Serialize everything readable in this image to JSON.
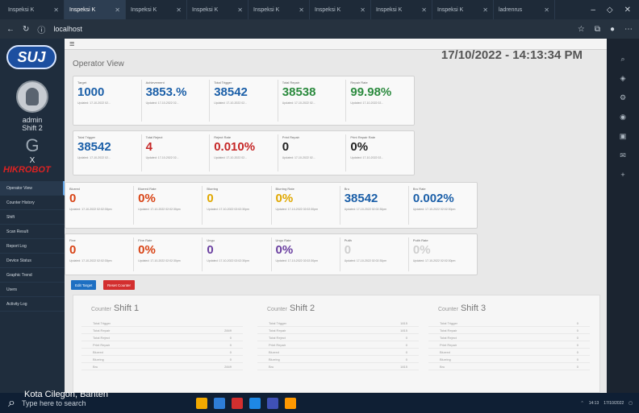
{
  "browser": {
    "tabs": [
      "Inspeksi K",
      "Inspeksi K",
      "Inspeksi K",
      "Inspeksi K",
      "Inspeksi K",
      "Inspeksi K",
      "Inspeksi K",
      "Inspeksi K",
      "ladrenrus"
    ],
    "active_tab": 1,
    "address": "localhost"
  },
  "sidebar": {
    "logo": "SUJ",
    "user": "admin",
    "shift": "Shift 2",
    "close": "X",
    "brand": "HIKROBOT",
    "menu": [
      "Operator View",
      "Counter History",
      "Shift",
      "Scan Result",
      "Report Log",
      "Device Status",
      "Graphic Trend",
      "Users",
      "Activity Log"
    ]
  },
  "header": {
    "title": "Operator View",
    "datetime": "17/10/2022 - 14:13:34 PM"
  },
  "row1": [
    {
      "label": "Target",
      "value": "1000",
      "updated": "Updated: 17-10-2022 02...",
      "color": "#1b5fa8"
    },
    {
      "label": "Achievement",
      "value": "3853.%",
      "updated": "Updated: 17-10-2022 02...",
      "color": "#1b5fa8"
    },
    {
      "label": "Total Trigger",
      "value": "38542",
      "updated": "Updated: 17-10-2022 02...",
      "color": "#1b5fa8"
    },
    {
      "label": "Total Repair",
      "value": "38538",
      "updated": "Updated: 17-10-2022 02...",
      "color": "#2b8a3e"
    },
    {
      "label": "Repair Rate",
      "value": "99.98%",
      "updated": "Updated: 17-10-2022 02...",
      "color": "#2b8a3e"
    }
  ],
  "row2": [
    {
      "label": "Total Trigger",
      "value": "38542",
      "updated": "Updated: 17-10-2022 02...",
      "color": "#1b5fa8"
    },
    {
      "label": "Total Reject",
      "value": "4",
      "updated": "Updated: 17-10-2022 02...",
      "color": "#c62828"
    },
    {
      "label": "Reject Rate",
      "value": "0.010%",
      "updated": "Updated: 17-10-2022 02...",
      "color": "#c62828"
    },
    {
      "label": "Print Repair",
      "value": "0",
      "updated": "Updated: 17-10-2022 02...",
      "color": "#222222"
    },
    {
      "label": "Print Repair Rate",
      "value": "0%",
      "updated": "Updated: 17-10-2022 02...",
      "color": "#222222"
    }
  ],
  "row3": [
    {
      "label": "Blurred",
      "value": "0",
      "updated": "Updated: 17-10-2022 02:02:30pm",
      "color": "#d84315"
    },
    {
      "label": "Blurred Rate",
      "value": "0%",
      "updated": "Updated: 17-10-2022 02:02:30pm",
      "color": "#d84315"
    },
    {
      "label": "Blurring",
      "value": "0",
      "updated": "Updated: 17-10-2022 02:02:30pm",
      "color": "#e0a800"
    },
    {
      "label": "Blurring Rate",
      "value": "0%",
      "updated": "Updated: 17-10-2022 02:02:30pm",
      "color": "#e0a800"
    },
    {
      "label": "Bru",
      "value": "38542",
      "updated": "Updated: 17-10-2022 02:02:30pm",
      "color": "#1b5fa8"
    },
    {
      "label": "Bru Rate",
      "value": "0.002%",
      "updated": "Updated: 17-10-2022 02:02:30pm",
      "color": "#1b5fa8"
    }
  ],
  "row4": [
    {
      "label": "Fine",
      "value": "0",
      "updated": "Updated: 17-10-2022 02:02:30pm",
      "color": "#d84315"
    },
    {
      "label": "Fine Rate",
      "value": "0%",
      "updated": "Updated: 17-10-2022 02:02:30pm",
      "color": "#d84315"
    },
    {
      "label": "Ungu",
      "value": "0",
      "updated": "Updated: 17-10-2022 02:02:30pm",
      "color": "#6a3fa0"
    },
    {
      "label": "Ungu Rate",
      "value": "0%",
      "updated": "Updated: 17-10-2022 02:02:30pm",
      "color": "#6a3fa0"
    },
    {
      "label": "Putih",
      "value": "0",
      "updated": "Updated: 17-10-2022 02:02:30pm",
      "color": "#cfcfcf"
    },
    {
      "label": "Putih Rate",
      "value": "0%",
      "updated": "Updated: 17-10-2022 02:02:30pm",
      "color": "#cfcfcf"
    }
  ],
  "buttons": {
    "edit_target": "Edit Target",
    "reset_counter": "Reset Counter",
    "edit_color": "#1e6fc2",
    "reset_color": "#d32f2f"
  },
  "counters": [
    {
      "prefix": "Counter",
      "title": "Shift 1",
      "rows": [
        [
          "Total Trigger",
          ""
        ],
        [
          "Total Repair",
          "2849"
        ],
        [
          "Total Reject",
          "0"
        ],
        [
          "Print Repair",
          "0"
        ],
        [
          "Blurred",
          "0"
        ],
        [
          "Blurring",
          "0"
        ],
        [
          "Bru",
          "2849"
        ]
      ]
    },
    {
      "prefix": "Counter",
      "title": "Shift 2",
      "rows": [
        [
          "Total Trigger",
          "1815"
        ],
        [
          "Total Repair",
          "1815"
        ],
        [
          "Total Reject",
          "0"
        ],
        [
          "Print Repair",
          "0"
        ],
        [
          "Blurred",
          "0"
        ],
        [
          "Blurring",
          "0"
        ],
        [
          "Bru",
          "1815"
        ]
      ]
    },
    {
      "prefix": "Counter",
      "title": "Shift 3",
      "rows": [
        [
          "Total Trigger",
          "0"
        ],
        [
          "Total Repair",
          "0"
        ],
        [
          "Total Reject",
          "0"
        ],
        [
          "Print Repair",
          "0"
        ],
        [
          "Blurred",
          "0"
        ],
        [
          "Blurring",
          "0"
        ],
        [
          "Bru",
          "0"
        ]
      ]
    }
  ],
  "taskbar": {
    "search_placeholder": "Type here to search",
    "location": "Kota Cilegon, Banten",
    "time": "14:13",
    "date": "17/10/2022"
  }
}
